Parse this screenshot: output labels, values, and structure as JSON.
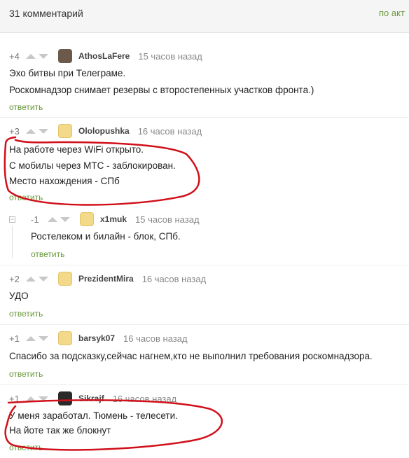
{
  "header": {
    "count_label": "31 комментарий",
    "sort_label": "по акт"
  },
  "reply_label": "ответить",
  "comments": [
    {
      "rating": "+4",
      "author": "AthosLaFere",
      "time": "15 часов назад",
      "lines": [
        "Эхо битвы при Телеграме.",
        "Роскомнадзор снимает резервы с второстепенных участков фронта.)"
      ]
    },
    {
      "rating": "+3",
      "author": "Ololopushka",
      "time": "16 часов назад",
      "lines": [
        "На работе через WiFi открыто.",
        "С мобилы через МТС - заблокирован.",
        "Место нахождения - СПб"
      ]
    },
    {
      "rating": "-1",
      "author": "x1muk",
      "time": "15 часов назад",
      "lines": [
        "Ростелеком и билайн - блок, СПб."
      ]
    },
    {
      "rating": "+2",
      "author": "PrezidentMira",
      "time": "16 часов назад",
      "lines": [
        "УДО"
      ]
    },
    {
      "rating": "+1",
      "author": "barsyk07",
      "time": "16 часов назад",
      "lines": [
        "Спасибо за подсказку,сейчас нагнем,кто не выполнил требования роскомнадзора."
      ]
    },
    {
      "rating": "+1",
      "author": "Sikrajf",
      "time": "16 часов назад",
      "lines": [
        "У меня заработал. Тюмень - телесети.",
        "На йоте так же блокнут"
      ]
    }
  ],
  "colors": {
    "accent": "#6a9a3c",
    "annotation": "#d0101a"
  },
  "icons": {
    "upvote": "triangle-up",
    "downvote": "triangle-down",
    "collapse": "minus-square"
  }
}
